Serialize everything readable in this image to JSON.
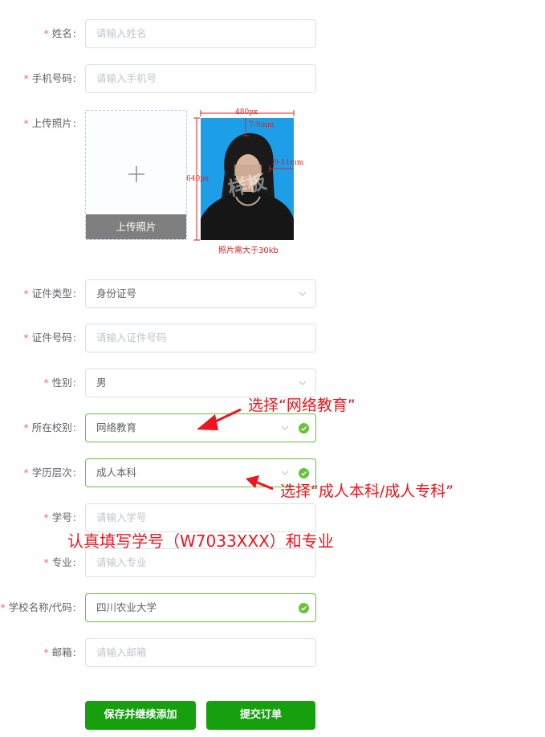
{
  "form": {
    "name": {
      "label": "姓名",
      "placeholder": "请输入姓名"
    },
    "phone": {
      "label": "手机号码",
      "placeholder": "请输入手机号"
    },
    "photo": {
      "label": "上传照片",
      "upload_text": "上传照片",
      "sample": {
        "width_text": "480px",
        "height_text": "640px",
        "top_margin_text": "7-9mm",
        "side_margin_text": "9-11mm",
        "watermark": "样板",
        "caption": "照片需大于30kb"
      }
    },
    "id_type": {
      "label": "证件类型",
      "value": "身份证号"
    },
    "id_number": {
      "label": "证件号码",
      "placeholder": "请输入证件号码"
    },
    "gender": {
      "label": "性别",
      "value": "男"
    },
    "campus": {
      "label": "所在校别",
      "value": "网络教育"
    },
    "level": {
      "label": "学历层次",
      "value": "成人本科"
    },
    "student_id": {
      "label": "学号",
      "placeholder": "请输入学号"
    },
    "major": {
      "label": "专业",
      "placeholder": "请输入专业"
    },
    "school": {
      "label": "学校名称/代码",
      "value": "四川农业大学"
    },
    "email": {
      "label": "邮箱",
      "placeholder": "请输入邮箱"
    }
  },
  "annotations": {
    "campus_tip": "选择“网络教育”",
    "level_tip": "选择“成人本科/成人专科”",
    "student_tip": "认真填写学号（W7033XXX）和专业"
  },
  "buttons": {
    "save_continue": "保存并继续添加",
    "submit": "提交订单"
  },
  "colors": {
    "required": "#f56c6c",
    "success": "#67c23a",
    "primary_button": "#16a00e",
    "annotation": "#f0141e"
  }
}
